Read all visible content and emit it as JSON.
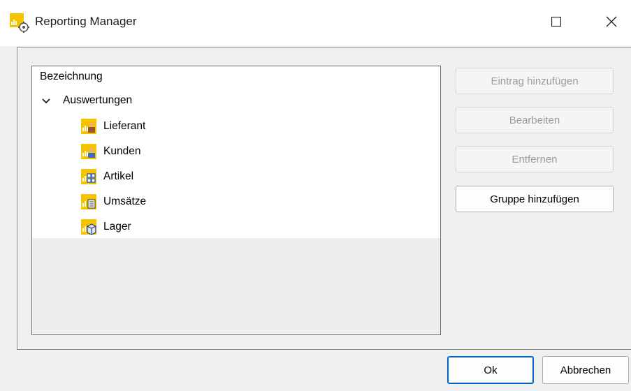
{
  "window": {
    "title": "Reporting Manager",
    "icon": "reporting-manager-icon",
    "controls": [
      "maximize-icon",
      "close-icon"
    ]
  },
  "tree": {
    "header": "Bezeichnung",
    "group": {
      "label": "Auswertungen",
      "expanded": true,
      "items": [
        {
          "label": "Lieferant",
          "icon": "lieferant-report-icon"
        },
        {
          "label": "Kunden",
          "icon": "kunden-report-icon"
        },
        {
          "label": "Artikel",
          "icon": "artikel-report-icon"
        },
        {
          "label": "Umsätze",
          "icon": "umsaetze-report-icon"
        },
        {
          "label": "Lager",
          "icon": "lager-report-icon"
        }
      ]
    }
  },
  "actions": {
    "add_entry": "Eintrag hinzufügen",
    "edit": "Bearbeiten",
    "remove": "Entfernen",
    "add_group": "Gruppe hinzufügen"
  },
  "footer": {
    "ok": "Ok",
    "cancel": "Abbrechen"
  },
  "colors": {
    "icon_yellow": "#f5c400",
    "accent": "#0067c0",
    "disabled_text": "#9b9b9b"
  }
}
